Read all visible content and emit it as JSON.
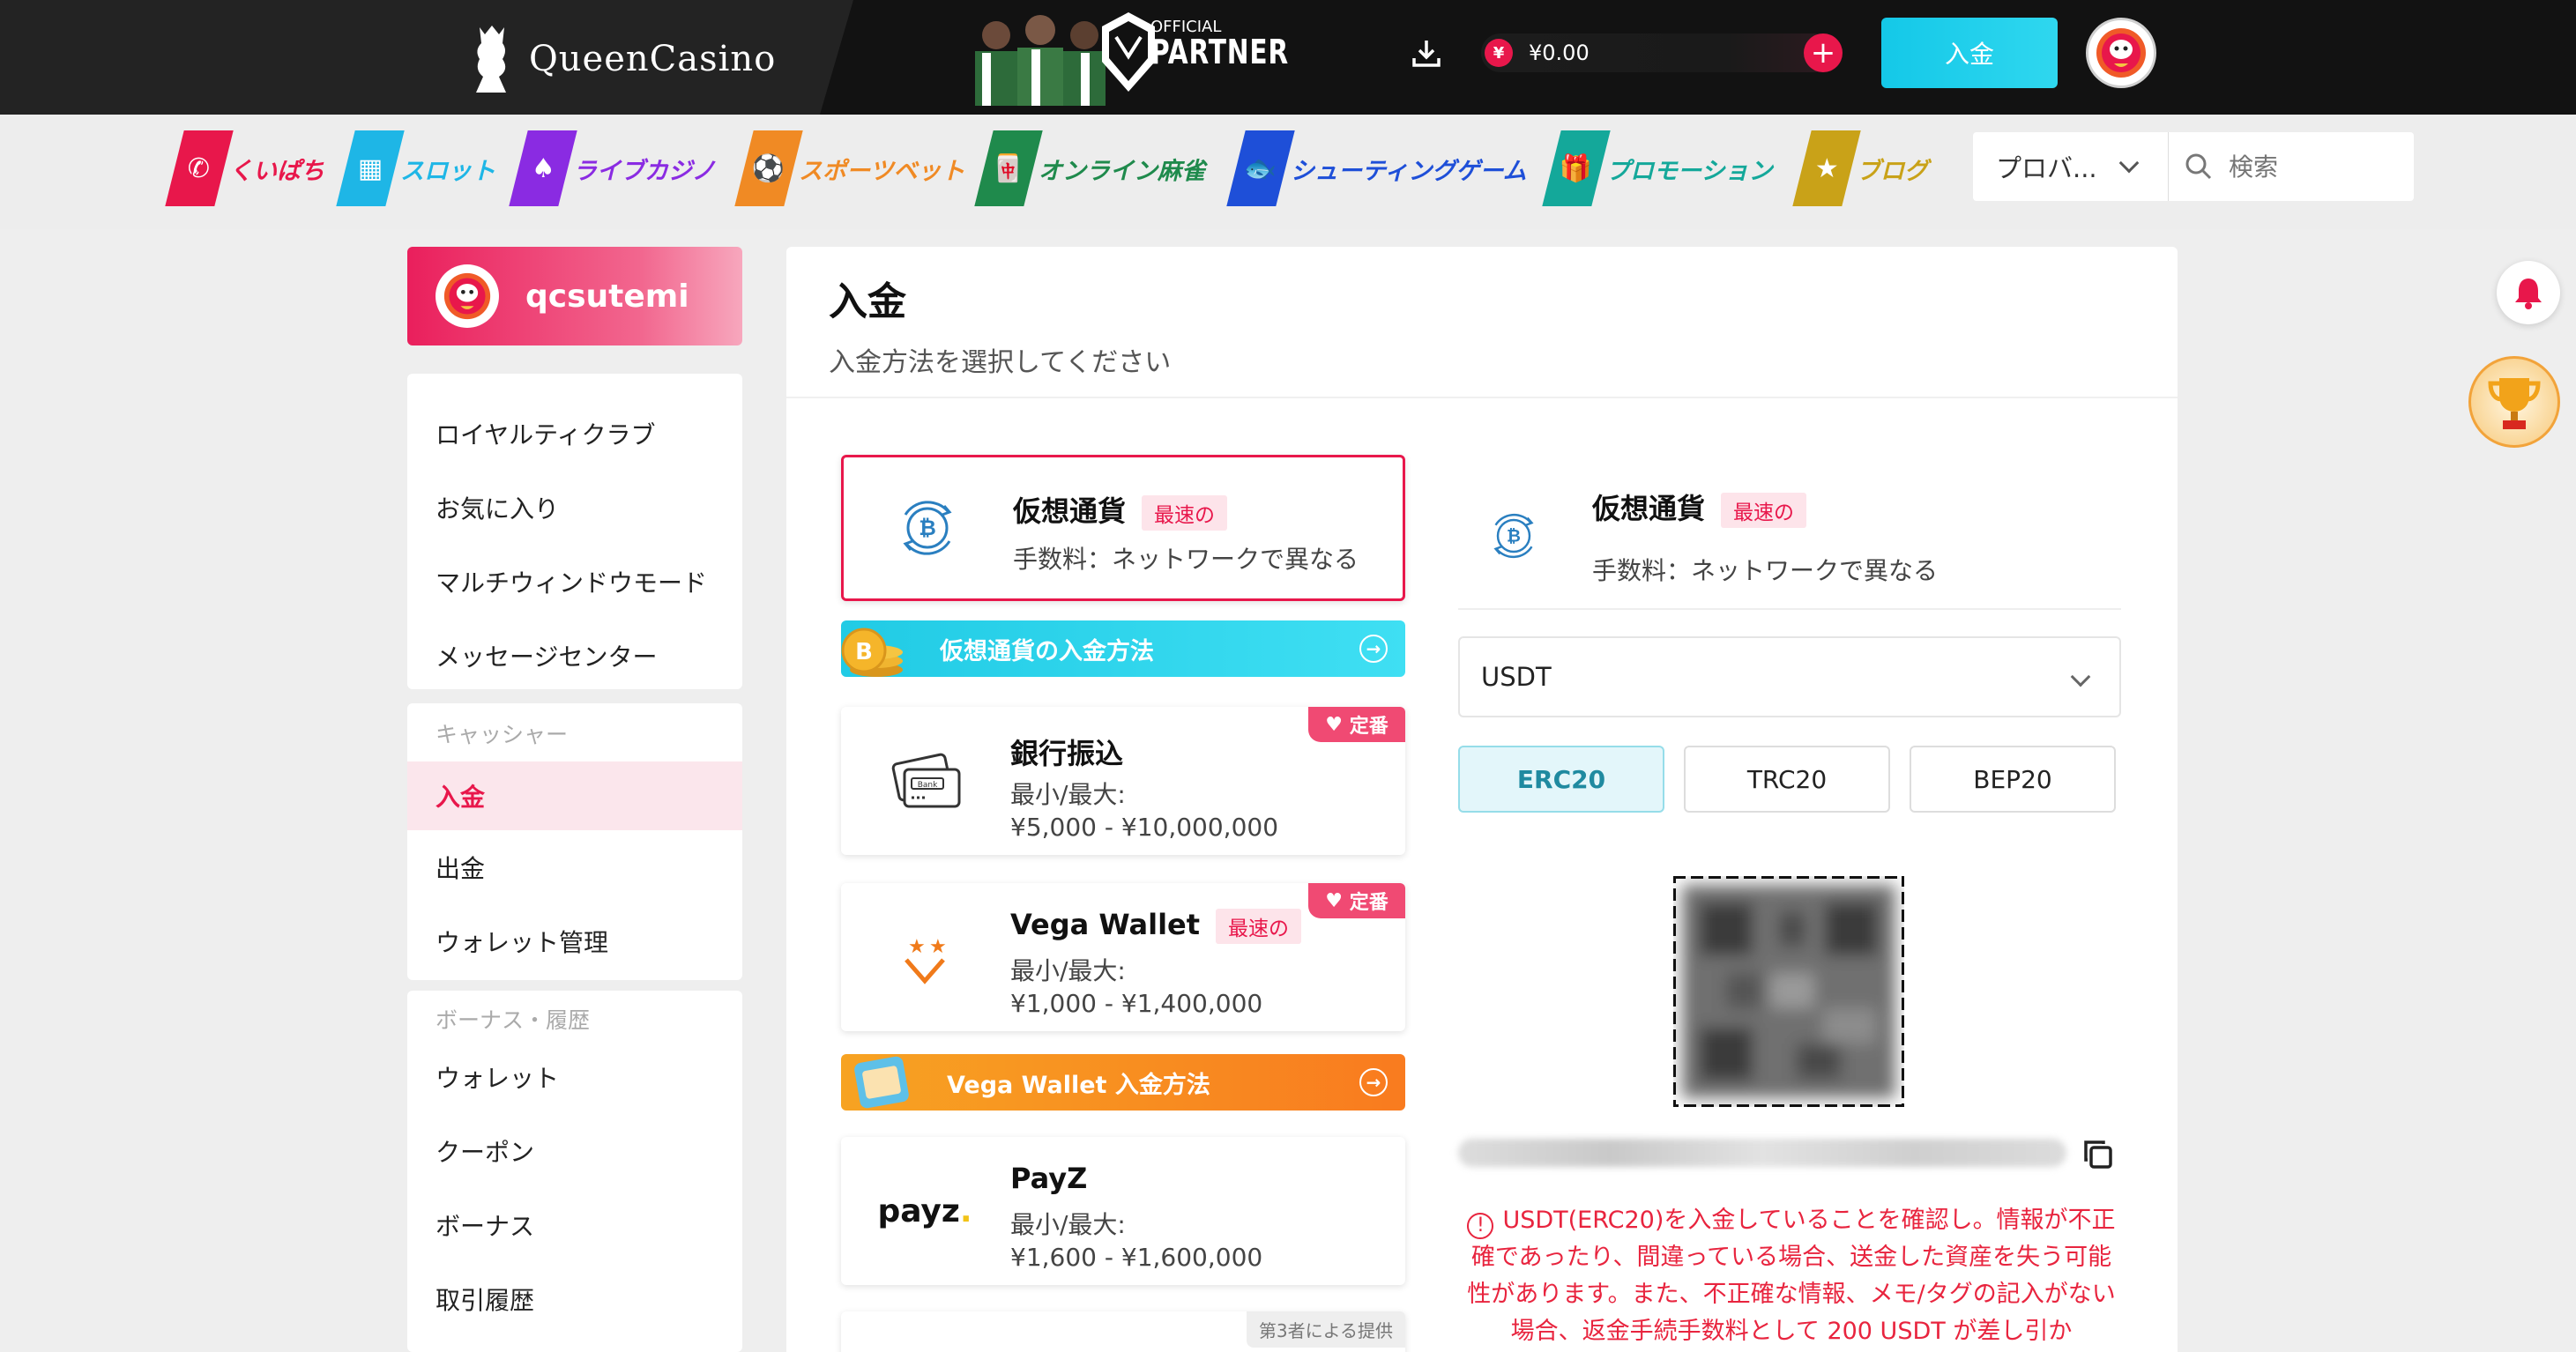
{
  "header": {
    "logo_text": "QueenCasino",
    "partner_small": "OFFICIAL",
    "partner_big": "PARTNER",
    "currency_symbol": "¥",
    "balance": "¥0.00",
    "plus_label": "+",
    "deposit_button": "入金"
  },
  "nav": {
    "items": [
      {
        "label": "くいぱち",
        "color": "#e8174b",
        "icon": "chat-bubble-icon"
      },
      {
        "label": "スロット",
        "color": "#1eb6e6",
        "icon": "slot-machine-icon"
      },
      {
        "label": "ライブカジノ",
        "color": "#8a2be2",
        "icon": "card-spade-icon"
      },
      {
        "label": "スポーツベット",
        "color": "#f08a24",
        "icon": "soccer-ball-icon"
      },
      {
        "label": "オンライン麻雀",
        "color": "#1f8a4c",
        "icon": "mahjong-tile-icon"
      },
      {
        "label": "シューティングゲーム",
        "color": "#1e4fd8",
        "icon": "fish-icon"
      },
      {
        "label": "プロモーション",
        "color": "#14a89a",
        "icon": "gift-icon"
      },
      {
        "label": "ブログ",
        "color": "#c9a218",
        "icon": "star-badge-icon"
      }
    ],
    "provider_select": "プロバ...",
    "search_placeholder": "検索"
  },
  "sidebar": {
    "username": "qcsutemi",
    "group1": [
      "ロイヤルティクラブ",
      "お気に入り",
      "マルチウィンドウモード",
      "メッセージセンター"
    ],
    "cashier_head": "キャッシャー",
    "cashier": [
      "入金",
      "出金",
      "ウォレット管理"
    ],
    "active": "入金",
    "bonus_head": "ボーナス・履歴",
    "bonus": [
      "ウォレット",
      "クーポン",
      "ボーナス",
      "取引履歴"
    ]
  },
  "main": {
    "title": "入金",
    "subtitle": "入金方法を選択してください",
    "methods": {
      "crypto": {
        "title": "仮想通貨",
        "tag": "最速の",
        "fee": "手数料：ネットワークで異なる"
      },
      "crypto_banner": "仮想通貨の入金方法",
      "bank": {
        "title": "銀行振込",
        "fav": "定番",
        "limit_label": "最小/最大:",
        "limit": "¥5,000 - ¥10,000,000"
      },
      "vega": {
        "title": "Vega Wallet",
        "tag": "最速の",
        "fav": "定番",
        "limit_label": "最小/最大:",
        "limit": "¥1,000 - ¥1,400,000"
      },
      "vega_banner": "Vega Wallet 入金方法",
      "payz": {
        "title": "PayZ",
        "logo": "payz",
        "limit_label": "最小/最大:",
        "limit": "¥1,600 - ¥1,600,000"
      },
      "third_party": "第3者による提供"
    }
  },
  "detail": {
    "title": "仮想通貨",
    "tag": "最速の",
    "fee": "手数料：ネットワークで異なる",
    "currency": "USDT",
    "networks": [
      "ERC20",
      "TRC20",
      "BEP20"
    ],
    "active_network": "ERC20",
    "warning": "USDT(ERC20)を入金していることを確認し。情報が不正確であったり、間違っている場合、送金した資産を失う可能性があります。また、不正確な情報、メモ/タグの記入がない場合、返金手続手数料として 200 USDT が差し引か"
  }
}
